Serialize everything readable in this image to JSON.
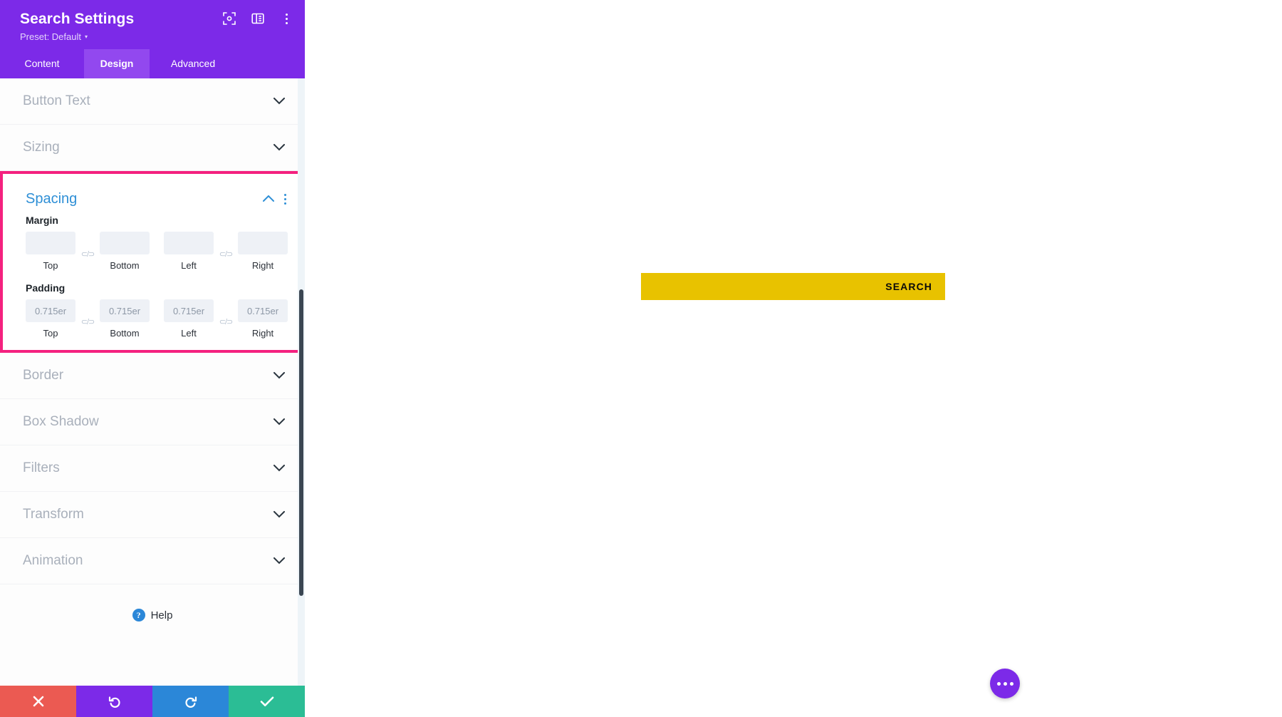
{
  "panel": {
    "title": "Search Settings",
    "preset_label": "Preset: Default",
    "preset_caret": "▾",
    "header_icons": [
      {
        "name": "focus-target-icon"
      },
      {
        "name": "layout-columns-icon"
      },
      {
        "name": "more-vertical-icon"
      }
    ],
    "tabs": [
      {
        "label": "Content",
        "active": false
      },
      {
        "label": "Design",
        "active": true
      },
      {
        "label": "Advanced",
        "active": false
      }
    ],
    "sections_above": [
      {
        "label": "Button Text",
        "expanded": false
      },
      {
        "label": "Sizing",
        "expanded": false
      }
    ],
    "spacing": {
      "title": "Spacing",
      "expanded": true,
      "highlight_color": "#f4217f",
      "title_color": "#2e8fd6",
      "margin": {
        "label": "Margin",
        "fields": [
          {
            "label": "Top",
            "value": "",
            "placeholder": ""
          },
          {
            "label": "Bottom",
            "value": "",
            "placeholder": ""
          },
          {
            "label": "Left",
            "value": "",
            "placeholder": ""
          },
          {
            "label": "Right",
            "value": "",
            "placeholder": ""
          }
        ],
        "link_icon": "⊂/⊃"
      },
      "padding": {
        "label": "Padding",
        "fields": [
          {
            "label": "Top",
            "value": "0.715er",
            "placeholder": "0.715er"
          },
          {
            "label": "Bottom",
            "value": "0.715er",
            "placeholder": "0.715er"
          },
          {
            "label": "Left",
            "value": "0.715er",
            "placeholder": "0.715er"
          },
          {
            "label": "Right",
            "value": "0.715er",
            "placeholder": "0.715er"
          }
        ],
        "link_icon": "⊂/⊃"
      }
    },
    "sections_below": [
      {
        "label": "Border",
        "expanded": false
      },
      {
        "label": "Box Shadow",
        "expanded": false
      },
      {
        "label": "Filters",
        "expanded": false
      },
      {
        "label": "Transform",
        "expanded": false
      },
      {
        "label": "Animation",
        "expanded": false
      }
    ],
    "help": {
      "label": "Help",
      "badge": "?"
    },
    "bottom_bar": [
      {
        "name": "cancel-button",
        "icon": "close-icon",
        "color": "#eb5a52"
      },
      {
        "name": "undo-button",
        "icon": "undo-icon",
        "color": "#7c2ae8"
      },
      {
        "name": "redo-button",
        "icon": "redo-icon",
        "color": "#2b87d8"
      },
      {
        "name": "save-button",
        "icon": "check-icon",
        "color": "#2bbd95"
      }
    ]
  },
  "canvas": {
    "search_module": {
      "button_label": "SEARCH",
      "background_color": "#e8c200",
      "text_color": "#0a0a0a",
      "input_value": "",
      "input_placeholder": ""
    },
    "fab": {
      "name": "more-options-fab",
      "color": "#7c2ae8"
    }
  }
}
